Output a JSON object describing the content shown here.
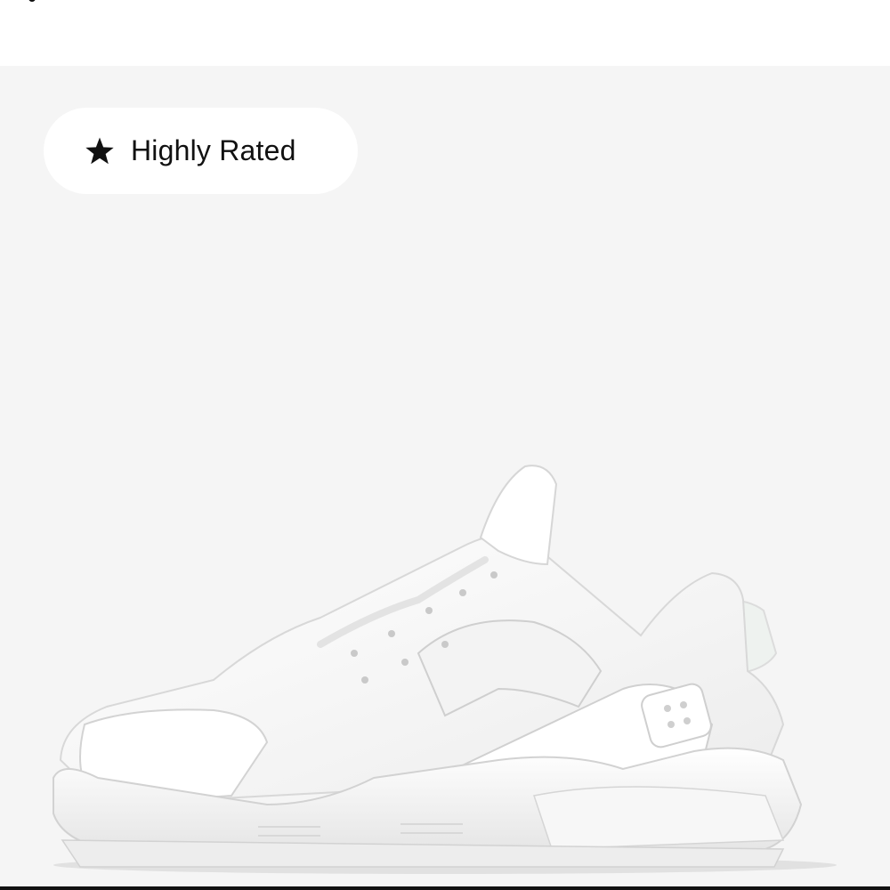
{
  "badge": {
    "icon": "star-icon",
    "label": "Highly Rated"
  },
  "product_image": {
    "icon": "sneaker-image"
  },
  "colors": {
    "panel_background": "#f5f5f5",
    "badge_background": "#ffffff",
    "text": "#111111",
    "bottom_bar": "#111111"
  }
}
